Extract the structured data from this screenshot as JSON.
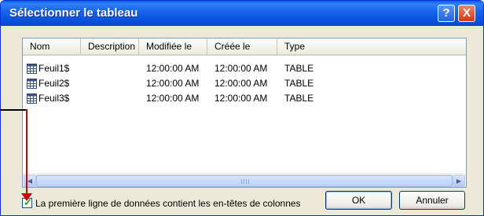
{
  "window": {
    "title": "Sélectionner le tableau",
    "help_glyph": "?",
    "close_glyph": "X"
  },
  "list": {
    "columns": [
      "Nom",
      "Description",
      "Modifiée le",
      "Créée le",
      "Type"
    ],
    "rows": [
      {
        "name": "Feuil1$",
        "description": "",
        "modified": "12:00:00 AM",
        "created": "12:00:00 AM",
        "type": "TABLE",
        "icon": "table-icon"
      },
      {
        "name": "Feuil2$",
        "description": "",
        "modified": "12:00:00 AM",
        "created": "12:00:00 AM",
        "type": "TABLE",
        "icon": "table-icon"
      },
      {
        "name": "Feuil3$",
        "description": "",
        "modified": "12:00:00 AM",
        "created": "12:00:00 AM",
        "type": "TABLE",
        "icon": "table-icon"
      }
    ],
    "scroll_left_glyph": "◀",
    "scroll_right_glyph": "▶"
  },
  "options": {
    "header_checkbox_label": "La première ligne de données contient les en-têtes de colonnes",
    "header_checkbox_checked": true,
    "check_glyph": "✓"
  },
  "buttons": {
    "ok_label": "OK",
    "cancel_label": "Annuler"
  },
  "colors": {
    "titlebar": "#0a52df",
    "dialog_bg": "#ece9d8",
    "annotation_arrow": "#cc0000",
    "checkmark": "#21a121"
  }
}
